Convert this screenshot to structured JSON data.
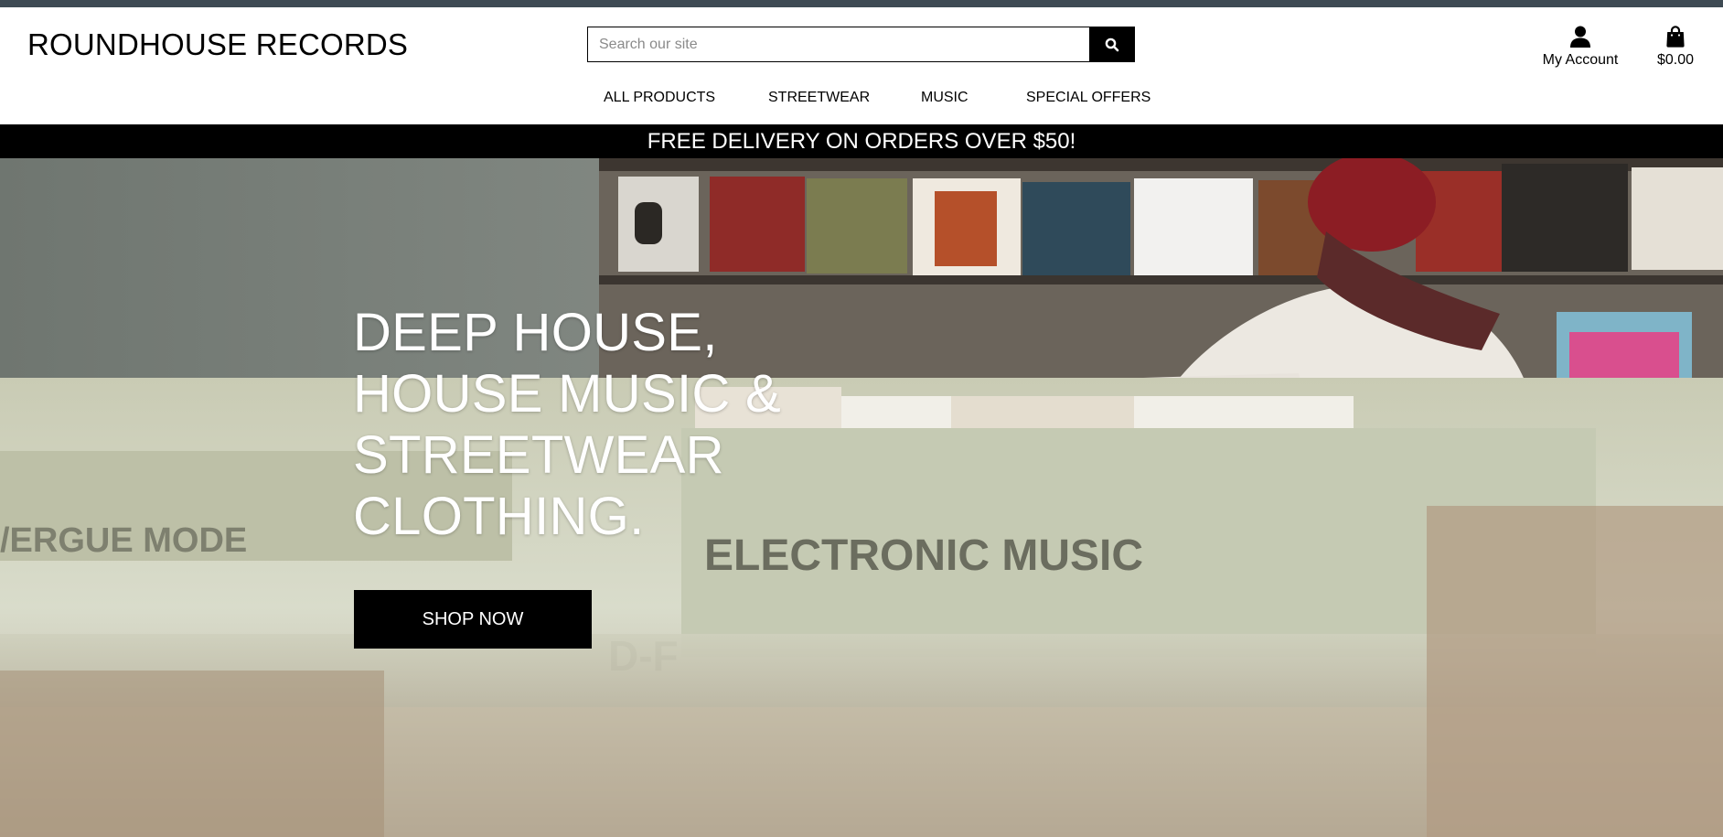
{
  "brand": {
    "name": "ROUNDHOUSE RECORDS"
  },
  "search": {
    "placeholder": "Search our site",
    "value": "",
    "icon": "search-icon"
  },
  "account": {
    "label": "My Account",
    "icon": "user-icon"
  },
  "cart": {
    "total": "$0.00",
    "icon": "shopping-bag-icon"
  },
  "nav": {
    "items": [
      {
        "label": "ALL PRODUCTS"
      },
      {
        "label": "STREETWEAR"
      },
      {
        "label": "MUSIC"
      },
      {
        "label": "SPECIAL OFFERS"
      }
    ]
  },
  "banner": {
    "text": "FREE DELIVERY ON ORDERS OVER $50!"
  },
  "hero": {
    "title_lines": [
      "DEEP HOUSE,",
      "HOUSE MUSIC &",
      "STREETWEAR",
      "CLOTHING."
    ],
    "cta_label": "SHOP NOW"
  },
  "colors": {
    "top_strip": "#3e4a53",
    "banner_bg": "#000000",
    "banner_text": "#ffffff",
    "cta_bg": "#000000",
    "cta_text": "#ffffff"
  }
}
